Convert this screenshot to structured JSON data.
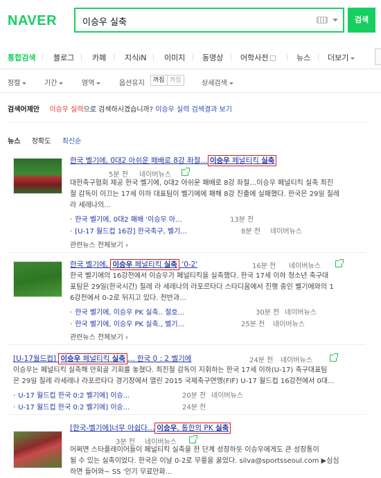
{
  "header": {
    "logo": "NAVER",
    "query": "이승우 실축",
    "search_button": "검색"
  },
  "tabs": [
    {
      "label": "통합검색"
    },
    {
      "label": "블로그"
    },
    {
      "label": "카페"
    },
    {
      "label": "지식iN"
    },
    {
      "label": "이미지"
    },
    {
      "label": "동영상"
    },
    {
      "label": "어학사전"
    },
    {
      "label": "뉴스"
    },
    {
      "label": "더보기"
    }
  ],
  "options": {
    "sort": "정렬",
    "period": "기간",
    "area": "영역",
    "keep": "옵션유지",
    "keep_on": "꺼짐",
    "keep_off": "켜짐",
    "detail": "상세검색"
  },
  "suggestion": {
    "label": "검색어제안",
    "red_term": "이승우 실력",
    "middle": "으로 검색하시겠습니까?",
    "link": "이승우 실력 검색결과 보기"
  },
  "news_header": {
    "title": "뉴스",
    "sort_accuracy": "정확도",
    "sort_latest": "최신순"
  },
  "items": [
    {
      "title_pre": "한국 벨기에, 0대2 아쉬운 패배로 8강 좌절…",
      "title_hl_bold": "이승우",
      "title_hl_rest": " 페널티킥 ",
      "title_hl_bold2": "실축",
      "time": "5분 전",
      "source": "네이버뉴스",
      "desc1": "대한축구협회 제공 한국 벨기에, 0대2 아쉬운 패배로 8강 좌절…이승우 페널티킥 실축 최진",
      "desc2": "철 감독이 이끄는 17세 이하 대표팀이 벨기에에 패해 8강 진출에 실패했다. 한국은 29일 칠레",
      "desc3": "라 세레나의...",
      "subs": [
        {
          "text": "한국 벨기에, 0대2 패배 '이승우 아...",
          "time": "13분 전",
          "source": ""
        },
        {
          "text": "[U-17 월드컵 16강] 한국축구, 벨기...",
          "time": "8분 전",
          "source": "네이버뉴스"
        }
      ],
      "more": "관련뉴스 전체보기"
    },
    {
      "title_pre": "한국 벨기에, ",
      "title_hl_bold": "이승우",
      "title_hl_rest": " 페널티킥 ",
      "title_hl_bold2": "실축",
      "title_post": " '0-2'",
      "time": "16분 전",
      "source": "네이버뉴스",
      "desc1": "한국 벨기에의 16강전에서 이승우가 페널티킥을 실축했다. 한국 17세 이하 청소년 축구대",
      "desc2": "표팀은 29일(한국시간) 칠레 라 세레나의 라포르타다 스타디움에서 진행 중인 벨기에와의 1",
      "desc3": "6강전에서 0-2로 뒤지고 있다. 전반과...",
      "subs": [
        {
          "text": "한국 벨기에, 이승우 PK 실축.. 절호...",
          "time": "30분 전",
          "source": "네이버뉴스"
        },
        {
          "text": "한국 벨기에, 이승우 PK 실축., 벨기...",
          "time": "25분 전",
          "source": "네이버뉴스"
        }
      ],
      "more": "관련뉴스 전체보기"
    },
    {
      "title_pre": "[U-17월드컵] ",
      "title_hl_bold": "이승우",
      "title_hl_rest": " 페널티킥 ",
      "title_hl_bold2": "실축",
      "title_post": "… 한국 0 : 2 벨기에",
      "time": "24분 전",
      "source": "네이버뉴스",
      "desc1": "이승우는 페널티킥 실축해 만회골 기회를 놓쳤다. 최진철 감독이 지휘하는 한국 17세 이하(U-17) 축구대표팀",
      "desc2": "은 29일 칠레 라세레나 라포르타다 경기장에서 열린 2015 국제축구연맹(FIF) U-17 월드컵 16강전에서 0대...",
      "subs": [
        {
          "text": "U-17 월드컵 한국 0:2 벨기에] 이승...",
          "time": "20분 전",
          "source": "네이버뉴스"
        },
        {
          "text": "U-17 월드컵 한국 0:2 벨기에] 이승...",
          "time": "24분 전",
          "source": ""
        }
      ]
    },
    {
      "title_pre": "[한국-벨기에]너무 아쉽다…",
      "title_hl_bold": "이승우",
      "title_hl_rest": ", 통한의 PK ",
      "title_hl_bold2": "실축",
      "time": "3분 전",
      "source": "네이버뉴스",
      "desc1": "어쩌면 스타플레이어들이 페널티킥 실축을 한 단계 성장하듯 이승우에게도 큰 성장통이",
      "desc2": "될 수 있는 실축이었다. 한국은 이날 0-2로 무릎을 꿇었다. silva@sportsseoul.com ▶심심",
      "desc3": "하면 들어와~ SS '인기 무료만화..."
    }
  ],
  "colors": {
    "brand": "#19ce60",
    "link": "#2236a6",
    "highlight_box": "#d61a1a",
    "suggest_red": "#e33333"
  }
}
